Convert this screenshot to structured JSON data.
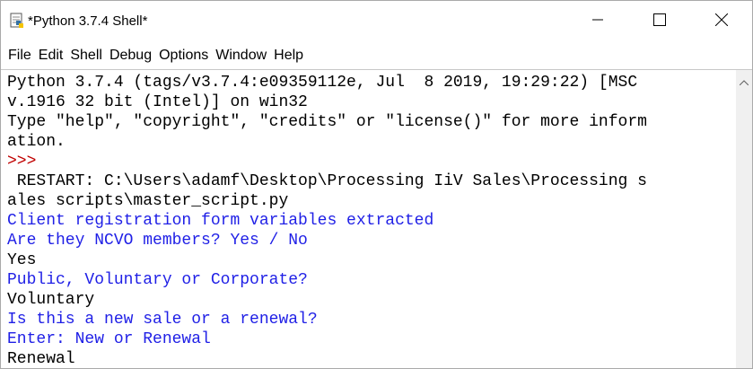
{
  "window": {
    "title": "*Python 3.7.4 Shell*"
  },
  "menu": [
    "File",
    "Edit",
    "Shell",
    "Debug",
    "Options",
    "Window",
    "Help"
  ],
  "shell_lines": [
    {
      "text": "Python 3.7.4 (tags/v3.7.4:e09359112e, Jul  8 2019, 19:29:22) [MSC",
      "color": "black"
    },
    {
      "text": "v.1916 32 bit (Intel)] on win32",
      "color": "black"
    },
    {
      "text": "Type \"help\", \"copyright\", \"credits\" or \"license()\" for more inform",
      "color": "black"
    },
    {
      "text": "ation.",
      "color": "black"
    },
    {
      "text": ">>> ",
      "color": "red"
    },
    {
      "text": " RESTART: C:\\Users\\adamf\\Desktop\\Processing IiV Sales\\Processing s",
      "color": "black"
    },
    {
      "text": "ales scripts\\master_script.py ",
      "color": "black"
    },
    {
      "text": "Client registration form variables extracted",
      "color": "blue"
    },
    {
      "text": "Are they NCVO members? Yes / No",
      "color": "blue"
    },
    {
      "text": "Yes",
      "color": "black"
    },
    {
      "text": "Public, Voluntary or Corporate?",
      "color": "blue"
    },
    {
      "text": "Voluntary",
      "color": "black"
    },
    {
      "text": "Is this a new sale or a renewal?",
      "color": "blue"
    },
    {
      "text": "Enter: New or Renewal",
      "color": "blue"
    },
    {
      "text": "Renewal",
      "color": "black"
    }
  ],
  "colors": {
    "stdout": "#1f1fe6",
    "prompt": "#c00000",
    "text": "#000000"
  },
  "icons": {
    "app": "python-idle-icon",
    "minimize": "minimize-icon",
    "maximize": "maximize-icon",
    "close": "close-icon",
    "scroll_up": "chevron-up-icon"
  }
}
